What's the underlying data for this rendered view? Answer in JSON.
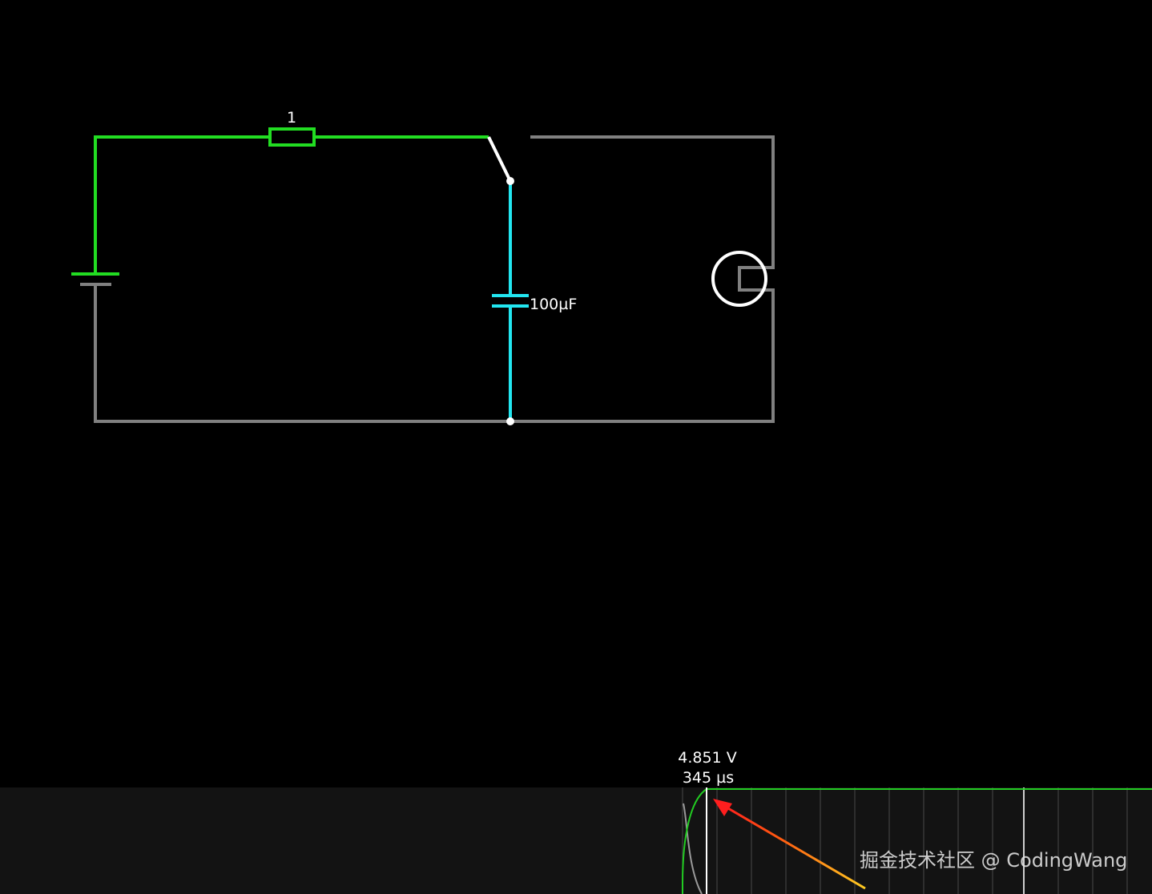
{
  "circuit": {
    "resistor_label": "1",
    "capacitor_label": "100µF",
    "colors": {
      "energized_wire": "#22dd22",
      "capacitor_wire": "#22e6f0",
      "idle_wire": "#808080",
      "node": "#ffffff",
      "background": "#000000"
    }
  },
  "scope": {
    "voltage_readout": "4.851 V",
    "time_readout": "345 µs",
    "trace_color": "#22cc22",
    "arrow_color": "#ff2020"
  },
  "watermark": "掘金技术社区 @ CodingWang"
}
